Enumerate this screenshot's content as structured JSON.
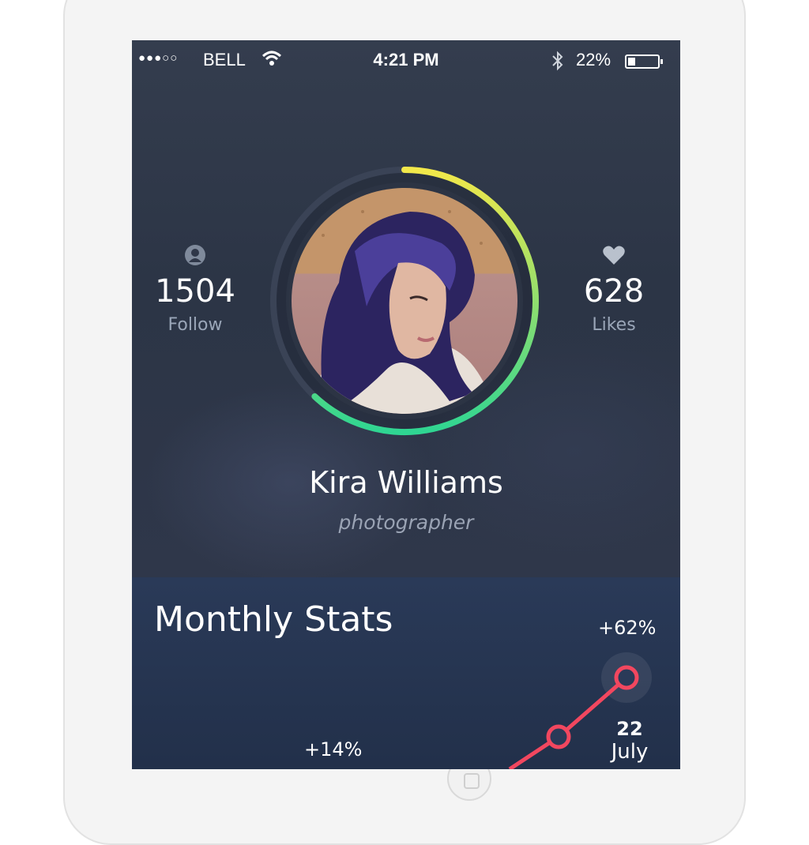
{
  "status_bar": {
    "signal": "●●●○○",
    "carrier": "BELL",
    "time": "4:21 PM",
    "battery_percent": "22%",
    "battery_level": 0.22
  },
  "profile": {
    "follow_count": "1504",
    "follow_label": "Follow",
    "likes_count": "628",
    "likes_label": "Likes",
    "name": "Kira Williams",
    "role": "photographer",
    "progress_ring": 0.62,
    "ring_colors": [
      "#f2e84a",
      "#2fd592"
    ]
  },
  "monthly_stats": {
    "title": "Monthly Stats",
    "high_pct": "+62%",
    "low_pct": "+14%",
    "date_day": "22",
    "date_month": "July",
    "line_color": "#f2475f"
  },
  "icons": {
    "follow": "user-icon",
    "likes": "heart-icon",
    "wifi": "wifi-icon",
    "bluetooth": "bluetooth-icon",
    "battery": "battery-icon"
  }
}
